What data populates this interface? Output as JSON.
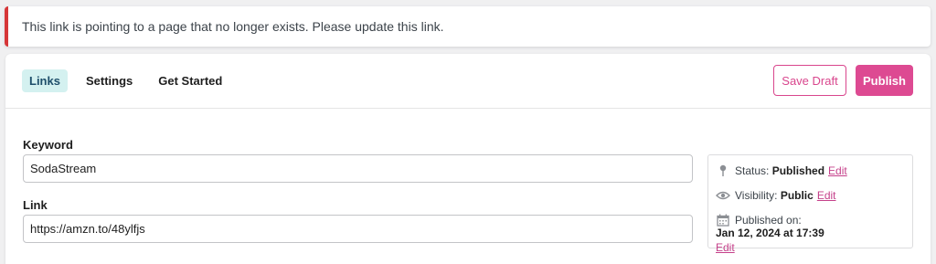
{
  "notice": {
    "message": "This link is pointing to a page that no longer exists. Please update this link."
  },
  "tabs": [
    {
      "label": "Links",
      "active": true
    },
    {
      "label": "Settings",
      "active": false
    },
    {
      "label": "Get Started",
      "active": false
    }
  ],
  "actions": {
    "save_draft": "Save Draft",
    "publish": "Publish"
  },
  "form": {
    "keyword_label": "Keyword",
    "keyword_value": "SodaStream",
    "link_label": "Link",
    "link_value": "https://amzn.to/48ylfjs"
  },
  "publish_box": {
    "status_label": "Status:",
    "status_value": "Published",
    "visibility_label": "Visibility:",
    "visibility_value": "Public",
    "published_on_label": "Published on:",
    "published_on_value": "Jan 12, 2024 at 17:39",
    "edit_label": "Edit"
  },
  "colors": {
    "accent": "#dd4a92",
    "notice_error": "#d63638",
    "active_tab_bg": "#d4f1f0"
  }
}
